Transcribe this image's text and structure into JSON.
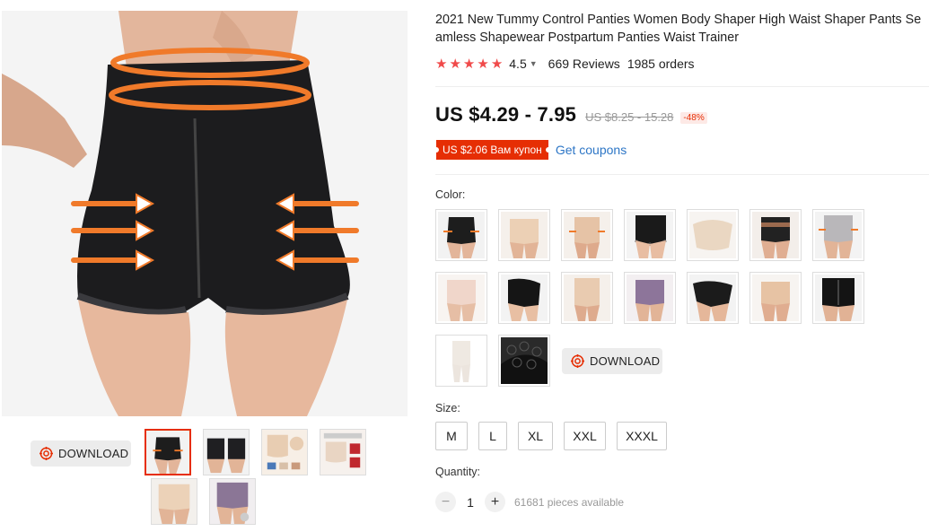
{
  "product": {
    "title": "2021 New Tummy Control Panties Women Body Shaper High Waist Shaper Pants Seamless Shapewear Postpartum Panties Waist Trainer",
    "rating": "4.5",
    "reviews": "669 Reviews",
    "orders": "1985 orders",
    "stars_filled": 5
  },
  "pricing": {
    "price": "US $4.29 - 7.95",
    "old_price": "US $8.25 - 15.28",
    "discount": "-48%",
    "coupon": "US $2.06 Вам купон",
    "get_coupons": "Get coupons"
  },
  "gallery": {
    "download_label": "DOWNLOAD",
    "thumbnails": [
      "black",
      "black-back",
      "nude-set",
      "nude-red",
      "nude",
      "purple"
    ]
  },
  "color": {
    "label": "Color:",
    "swatches": [
      "black-front",
      "nude-front",
      "nude-2",
      "black-lace",
      "beige",
      "black-belt",
      "grey",
      "pink-nude",
      "black-side",
      "nude-3",
      "purple",
      "black-4",
      "nude-4",
      "black-zip",
      "white",
      "black-lace-2"
    ],
    "download_label": "DOWNLOAD"
  },
  "size": {
    "label": "Size:",
    "options": [
      "M",
      "L",
      "XL",
      "XXL",
      "XXXL"
    ]
  },
  "quantity": {
    "label": "Quantity:",
    "value": "1",
    "minus": "−",
    "plus": "+",
    "available": "61681 pieces available"
  },
  "colors": {
    "accent": "#e62e04",
    "star": "#f04a4a",
    "link": "#2d76c6",
    "price": "#111111"
  },
  "icons": {
    "rating_caret": "chevron-down-icon",
    "download": "target-icon"
  }
}
